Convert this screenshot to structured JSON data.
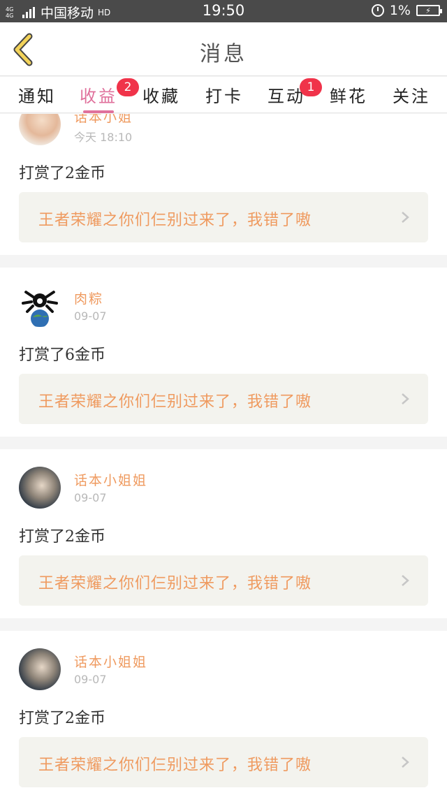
{
  "status_bar": {
    "network": "4G 4G",
    "carrier": "中国移动",
    "hd": "HD",
    "time": "19:50",
    "battery": "1%"
  },
  "header": {
    "title": "消息"
  },
  "tabs": [
    {
      "label": "通知"
    },
    {
      "label": "收益",
      "active": true,
      "badge": "2"
    },
    {
      "label": "收藏"
    },
    {
      "label": "打卡"
    },
    {
      "label": "互动",
      "badge": "1"
    },
    {
      "label": "鲜花"
    },
    {
      "label": "关注"
    }
  ],
  "messages": [
    {
      "user": "话本小姐",
      "time": "今天 18:10",
      "reward": "打赏了2金币",
      "post": "王者荣耀之你们仨别过来了，我错了嗷"
    },
    {
      "user": "肉粽",
      "time": "09-07",
      "reward": "打赏了6金币",
      "post": "王者荣耀之你们仨别过来了，我错了嗷"
    },
    {
      "user": "话本小姐姐",
      "time": "09-07",
      "reward": "打赏了2金币",
      "post": "王者荣耀之你们仨别过来了，我错了嗷"
    },
    {
      "user": "话本小姐姐",
      "time": "09-07",
      "reward": "打赏了2金币",
      "post": "王者荣耀之你们仨别过来了，我错了嗷"
    }
  ],
  "colors": {
    "accent": "#e0719c",
    "name": "#ef9a5f",
    "badge": "#f0334a"
  }
}
